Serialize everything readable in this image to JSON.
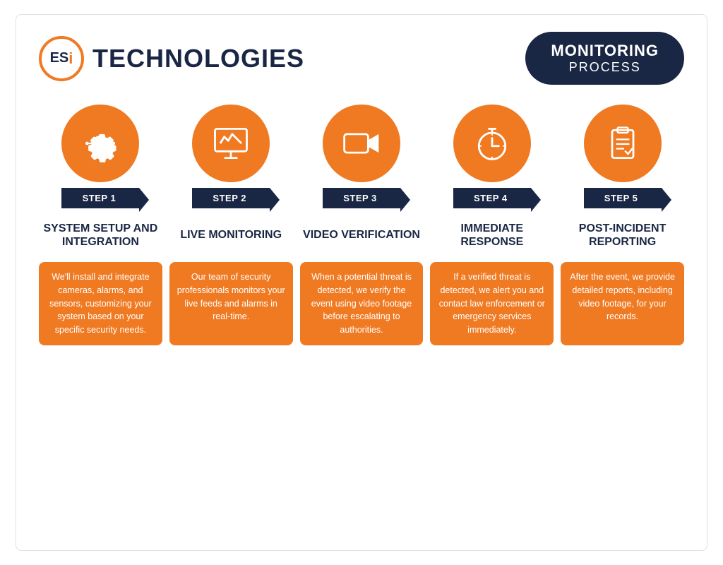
{
  "header": {
    "logo_letters": "ESi",
    "logo_company": "TECHNOLOGIES",
    "badge_line1": "MONITORING",
    "badge_line2": "PROCESS"
  },
  "steps": [
    {
      "id": "step1",
      "label": "STEP 1",
      "icon": "gear",
      "title": "SYSTEM SETUP AND INTEGRATION",
      "description": "We'll install and integrate cameras, alarms, and sensors, customizing your system based on your specific security needs."
    },
    {
      "id": "step2",
      "label": "STEP 2",
      "icon": "monitor",
      "title": "LIVE MONITORING",
      "description": "Our team of security professionals monitors your live feeds and alarms in real-time."
    },
    {
      "id": "step3",
      "label": "STEP 3",
      "icon": "camera",
      "title": "VIDEO VERIFICATION",
      "description": "When a potential threat is detected, we verify the event using video footage before escalating to authorities."
    },
    {
      "id": "step4",
      "label": "STEP 4",
      "icon": "stopwatch",
      "title": "IMMEDIATE RESPONSE",
      "description": "If a verified threat is detected, we alert you and contact law enforcement or emergency services immediately."
    },
    {
      "id": "step5",
      "label": "STEP 5",
      "icon": "clipboard",
      "title": "POST-INCIDENT REPORTING",
      "description": "After the event, we provide detailed reports, including video footage, for your records."
    }
  ]
}
